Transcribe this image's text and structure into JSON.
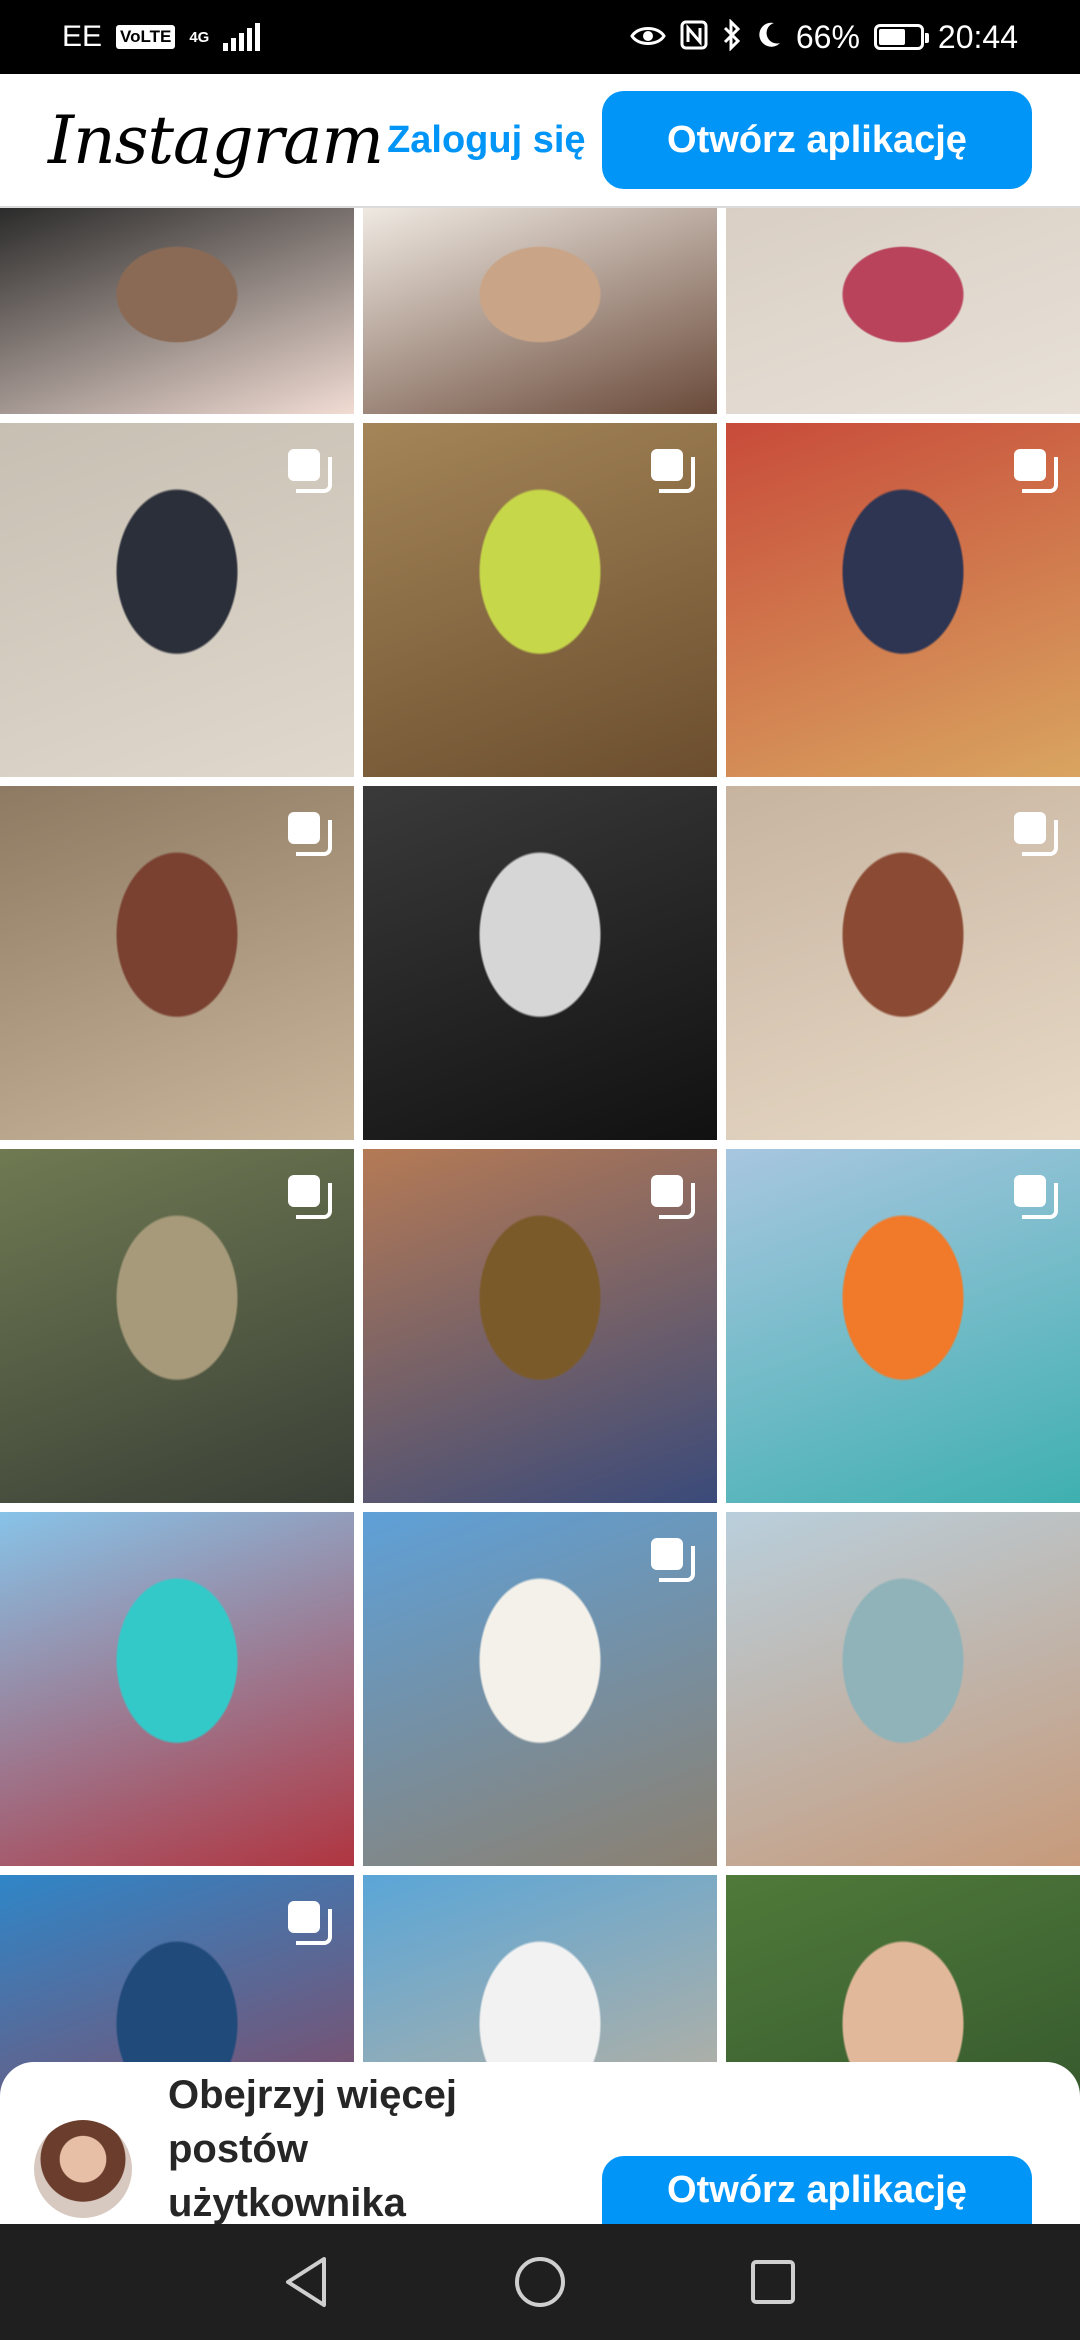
{
  "status_bar": {
    "carrier": "EE",
    "volte": "VoLTE",
    "network": "4G",
    "battery": "66%",
    "battery_level": 0.66,
    "time": "20:44",
    "icons": [
      "eye-icon",
      "nfc-icon",
      "bluetooth-icon",
      "moon-icon"
    ]
  },
  "header": {
    "logo": "Instagram",
    "login_label": "Zaloguj się",
    "open_app_label": "Otwórz aplikację"
  },
  "grid": {
    "posts": [
      {
        "multi": false,
        "colors": [
          "#2b2b2b",
          "#8a6a55",
          "#f1dcd3"
        ]
      },
      {
        "multi": false,
        "colors": [
          "#efe9e2",
          "#c9a487",
          "#6a4a3a"
        ]
      },
      {
        "multi": false,
        "colors": [
          "#d9cfc4",
          "#b8435a",
          "#e8e1d8"
        ]
      },
      {
        "multi": true,
        "colors": [
          "#c7bfb2",
          "#2b2f3a",
          "#e0d8cc"
        ]
      },
      {
        "multi": true,
        "colors": [
          "#a48558",
          "#c7d74a",
          "#6b4e2e"
        ]
      },
      {
        "multi": true,
        "colors": [
          "#c84b3a",
          "#2e3553",
          "#d9a560"
        ]
      },
      {
        "multi": true,
        "colors": [
          "#8e7a62",
          "#7a4030",
          "#c9b69b"
        ]
      },
      {
        "multi": false,
        "colors": [
          "#3a3a3a",
          "#d6d6d6",
          "#111111"
        ]
      },
      {
        "multi": true,
        "colors": [
          "#c7b4a0",
          "#8b4a33",
          "#e7d9c6"
        ]
      },
      {
        "multi": true,
        "colors": [
          "#6f7a52",
          "#a69a7a",
          "#3a3f36"
        ]
      },
      {
        "multi": true,
        "colors": [
          "#b57a55",
          "#7b5a2a",
          "#3a4a7a"
        ]
      },
      {
        "multi": true,
        "colors": [
          "#a8c6e0",
          "#f07a2a",
          "#3fb0b0"
        ]
      },
      {
        "multi": false,
        "colors": [
          "#87c3e8",
          "#33c9c9",
          "#b03540"
        ]
      },
      {
        "multi": true,
        "colors": [
          "#5ea0d8",
          "#f4f1ea",
          "#8c8070"
        ]
      },
      {
        "multi": false,
        "colors": [
          "#b9cfdc",
          "#8fb3b9",
          "#c79a7a"
        ]
      },
      {
        "multi": true,
        "colors": [
          "#2f86c8",
          "#1f4a7a",
          "#9a3a4a"
        ]
      },
      {
        "multi": false,
        "colors": [
          "#5aa6d8",
          "#f2f2f2",
          "#d7b48f"
        ]
      },
      {
        "multi": false,
        "colors": [
          "#4f7a3a",
          "#e2b89a",
          "#2f4f2a"
        ]
      }
    ]
  },
  "sheet": {
    "text": "Obejrzyj więcej postów użytkownika",
    "open_app_label": "Otwórz aplikację"
  },
  "navbar": {
    "icons": [
      "back-icon",
      "home-icon",
      "recents-icon"
    ]
  }
}
